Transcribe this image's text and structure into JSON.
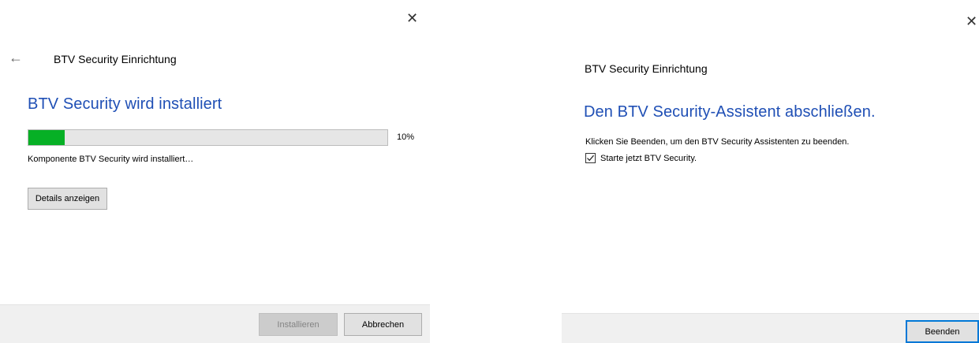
{
  "left": {
    "dialog_title": "BTV Security Einrichtung",
    "heading": "BTV Security wird installiert",
    "progress": {
      "percent_value": 10,
      "percent_label": "10%"
    },
    "status_text": "Komponente BTV Security wird installiert…",
    "details_button": "Details anzeigen",
    "install_button": "Installieren",
    "cancel_button": "Abbrechen"
  },
  "right": {
    "dialog_title": "BTV Security Einrichtung",
    "heading": "Den BTV Security-Assistent abschließen.",
    "description": "Klicken Sie Beenden, um den BTV Security Assistenten zu beenden.",
    "checkbox_label": "Starte jetzt BTV Security.",
    "checkbox_checked": true,
    "finish_button": "Beenden"
  },
  "icons": {
    "close": "✕",
    "back": "←"
  },
  "colors": {
    "heading": "#1f4fb5",
    "progress_fill": "#06b025",
    "focus_border": "#0078d7"
  }
}
